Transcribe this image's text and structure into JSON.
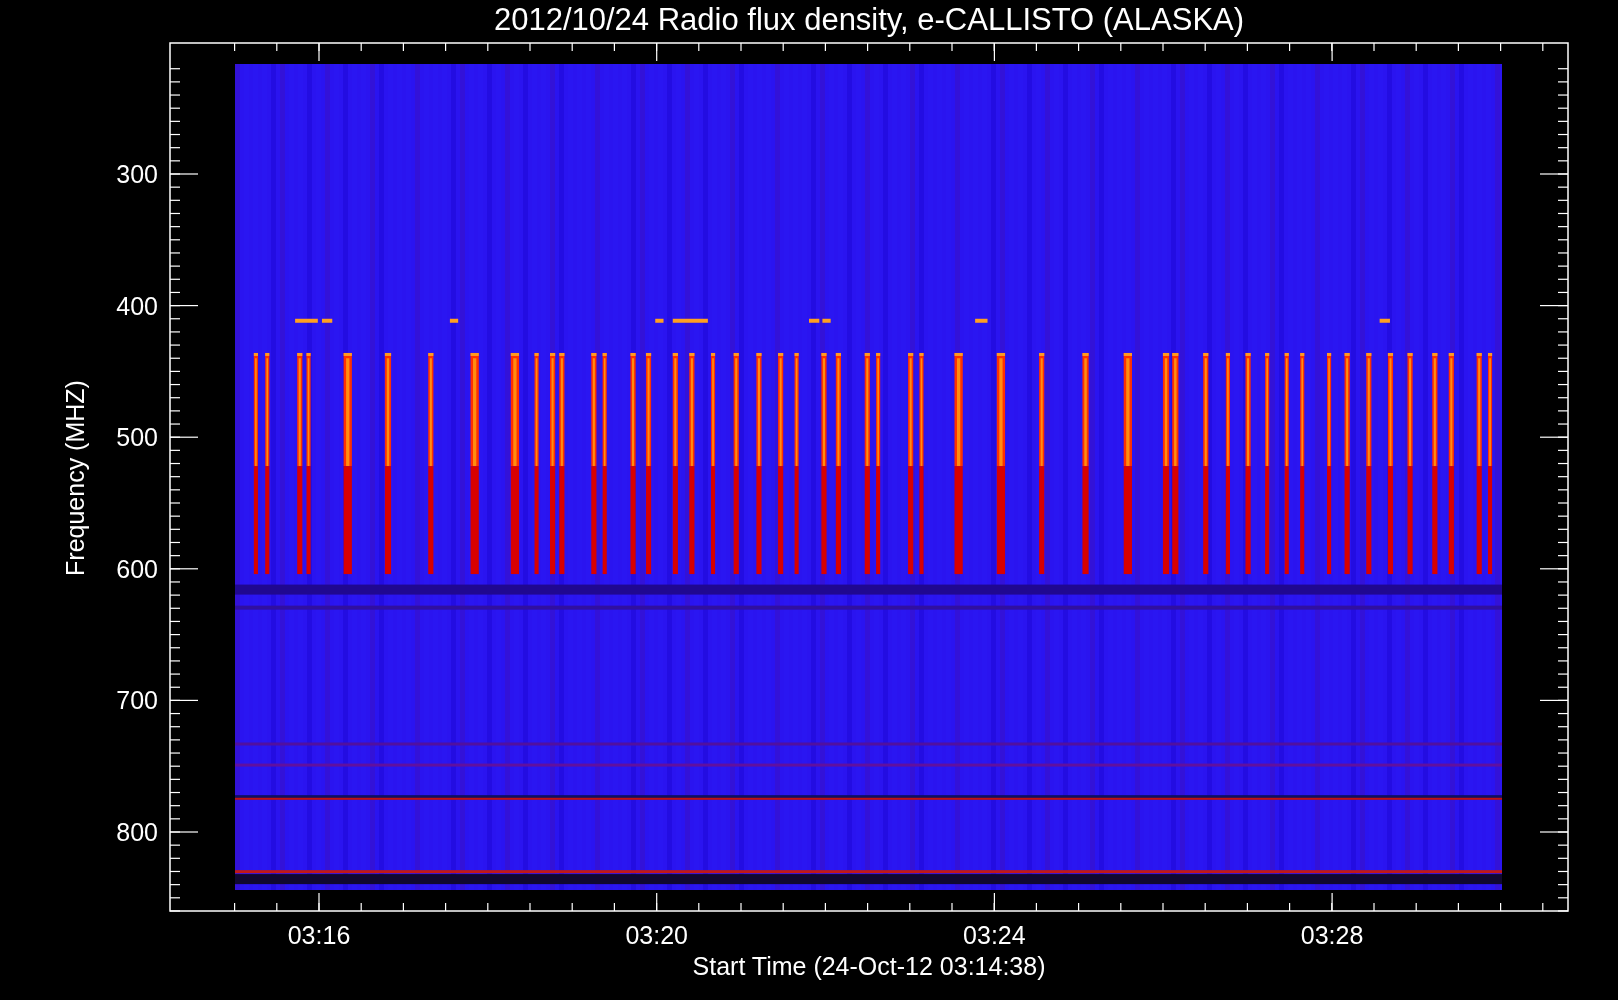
{
  "title": "2012/10/24  Radio flux density, e-CALLISTO (ALASKA)",
  "xlabel": "Start Time (24-Oct-12 03:14:38)",
  "ylabel": "Frequency (MHZ)",
  "xticks": [
    "03:16",
    "03:20",
    "03:24",
    "03:28"
  ],
  "yticks": [
    "300",
    "400",
    "500",
    "600",
    "700",
    "800"
  ]
}
